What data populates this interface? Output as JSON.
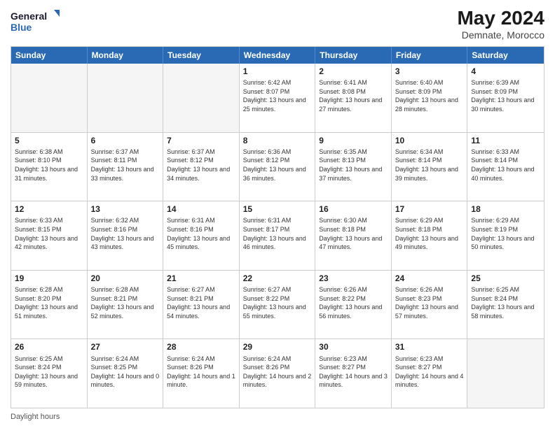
{
  "logo": {
    "line1": "General",
    "line2": "Blue"
  },
  "title": "May 2024",
  "location": "Demnate, Morocco",
  "days_of_week": [
    "Sunday",
    "Monday",
    "Tuesday",
    "Wednesday",
    "Thursday",
    "Friday",
    "Saturday"
  ],
  "footer_text": "Daylight hours",
  "weeks": [
    [
      {
        "day": "",
        "info": ""
      },
      {
        "day": "",
        "info": ""
      },
      {
        "day": "",
        "info": ""
      },
      {
        "day": "1",
        "info": "Sunrise: 6:42 AM\nSunset: 8:07 PM\nDaylight: 13 hours and 25 minutes."
      },
      {
        "day": "2",
        "info": "Sunrise: 6:41 AM\nSunset: 8:08 PM\nDaylight: 13 hours and 27 minutes."
      },
      {
        "day": "3",
        "info": "Sunrise: 6:40 AM\nSunset: 8:09 PM\nDaylight: 13 hours and 28 minutes."
      },
      {
        "day": "4",
        "info": "Sunrise: 6:39 AM\nSunset: 8:09 PM\nDaylight: 13 hours and 30 minutes."
      }
    ],
    [
      {
        "day": "5",
        "info": "Sunrise: 6:38 AM\nSunset: 8:10 PM\nDaylight: 13 hours and 31 minutes."
      },
      {
        "day": "6",
        "info": "Sunrise: 6:37 AM\nSunset: 8:11 PM\nDaylight: 13 hours and 33 minutes."
      },
      {
        "day": "7",
        "info": "Sunrise: 6:37 AM\nSunset: 8:12 PM\nDaylight: 13 hours and 34 minutes."
      },
      {
        "day": "8",
        "info": "Sunrise: 6:36 AM\nSunset: 8:12 PM\nDaylight: 13 hours and 36 minutes."
      },
      {
        "day": "9",
        "info": "Sunrise: 6:35 AM\nSunset: 8:13 PM\nDaylight: 13 hours and 37 minutes."
      },
      {
        "day": "10",
        "info": "Sunrise: 6:34 AM\nSunset: 8:14 PM\nDaylight: 13 hours and 39 minutes."
      },
      {
        "day": "11",
        "info": "Sunrise: 6:33 AM\nSunset: 8:14 PM\nDaylight: 13 hours and 40 minutes."
      }
    ],
    [
      {
        "day": "12",
        "info": "Sunrise: 6:33 AM\nSunset: 8:15 PM\nDaylight: 13 hours and 42 minutes."
      },
      {
        "day": "13",
        "info": "Sunrise: 6:32 AM\nSunset: 8:16 PM\nDaylight: 13 hours and 43 minutes."
      },
      {
        "day": "14",
        "info": "Sunrise: 6:31 AM\nSunset: 8:16 PM\nDaylight: 13 hours and 45 minutes."
      },
      {
        "day": "15",
        "info": "Sunrise: 6:31 AM\nSunset: 8:17 PM\nDaylight: 13 hours and 46 minutes."
      },
      {
        "day": "16",
        "info": "Sunrise: 6:30 AM\nSunset: 8:18 PM\nDaylight: 13 hours and 47 minutes."
      },
      {
        "day": "17",
        "info": "Sunrise: 6:29 AM\nSunset: 8:18 PM\nDaylight: 13 hours and 49 minutes."
      },
      {
        "day": "18",
        "info": "Sunrise: 6:29 AM\nSunset: 8:19 PM\nDaylight: 13 hours and 50 minutes."
      }
    ],
    [
      {
        "day": "19",
        "info": "Sunrise: 6:28 AM\nSunset: 8:20 PM\nDaylight: 13 hours and 51 minutes."
      },
      {
        "day": "20",
        "info": "Sunrise: 6:28 AM\nSunset: 8:21 PM\nDaylight: 13 hours and 52 minutes."
      },
      {
        "day": "21",
        "info": "Sunrise: 6:27 AM\nSunset: 8:21 PM\nDaylight: 13 hours and 54 minutes."
      },
      {
        "day": "22",
        "info": "Sunrise: 6:27 AM\nSunset: 8:22 PM\nDaylight: 13 hours and 55 minutes."
      },
      {
        "day": "23",
        "info": "Sunrise: 6:26 AM\nSunset: 8:22 PM\nDaylight: 13 hours and 56 minutes."
      },
      {
        "day": "24",
        "info": "Sunrise: 6:26 AM\nSunset: 8:23 PM\nDaylight: 13 hours and 57 minutes."
      },
      {
        "day": "25",
        "info": "Sunrise: 6:25 AM\nSunset: 8:24 PM\nDaylight: 13 hours and 58 minutes."
      }
    ],
    [
      {
        "day": "26",
        "info": "Sunrise: 6:25 AM\nSunset: 8:24 PM\nDaylight: 13 hours and 59 minutes."
      },
      {
        "day": "27",
        "info": "Sunrise: 6:24 AM\nSunset: 8:25 PM\nDaylight: 14 hours and 0 minutes."
      },
      {
        "day": "28",
        "info": "Sunrise: 6:24 AM\nSunset: 8:26 PM\nDaylight: 14 hours and 1 minute."
      },
      {
        "day": "29",
        "info": "Sunrise: 6:24 AM\nSunset: 8:26 PM\nDaylight: 14 hours and 2 minutes."
      },
      {
        "day": "30",
        "info": "Sunrise: 6:23 AM\nSunset: 8:27 PM\nDaylight: 14 hours and 3 minutes."
      },
      {
        "day": "31",
        "info": "Sunrise: 6:23 AM\nSunset: 8:27 PM\nDaylight: 14 hours and 4 minutes."
      },
      {
        "day": "",
        "info": ""
      }
    ]
  ]
}
